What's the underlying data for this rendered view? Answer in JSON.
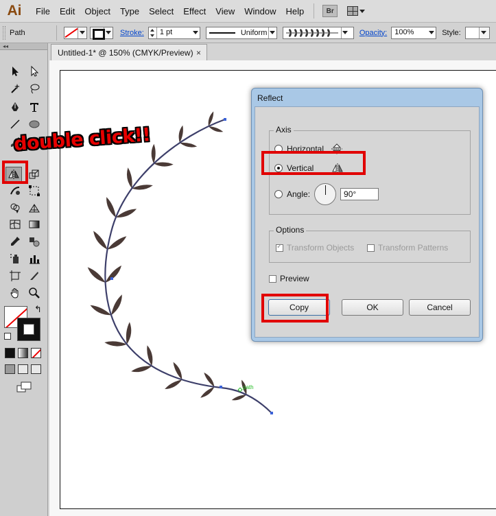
{
  "app": {
    "logo": "Ai"
  },
  "menu": [
    "File",
    "Edit",
    "Object",
    "Type",
    "Select",
    "Effect",
    "View",
    "Window",
    "Help"
  ],
  "menubar_extra": {
    "bridge": "Br"
  },
  "control_bar": {
    "selection": "Path",
    "stroke_label": "Stroke:",
    "stroke_value": "1 pt",
    "profile": "Uniform",
    "opacity_label": "Opacity:",
    "opacity_value": "100%",
    "style_label": "Style:"
  },
  "document_tab": {
    "title": "Untitled-1* @ 150% (CMYK/Preview)",
    "close": "×"
  },
  "annotation": {
    "text": "double click!!"
  },
  "artwork": {
    "smart_guide_label": "path",
    "leaf_color": "#4a3a36",
    "stem_color": "#3d3f6a"
  },
  "dialog": {
    "title": "Reflect",
    "axis": {
      "label": "Axis",
      "horizontal": "Horizontal",
      "vertical": "Vertical",
      "angle_label": "Angle:",
      "angle_value": "90°",
      "selected": "vertical"
    },
    "options": {
      "label": "Options",
      "transform_objects": "Transform Objects",
      "transform_patterns": "Transform Patterns"
    },
    "preview": "Preview",
    "buttons": {
      "copy": "Copy",
      "ok": "OK",
      "cancel": "Cancel"
    }
  },
  "colors": {
    "highlight_red": "#e10000",
    "dialog_frame": "#a9c8e6",
    "link_blue": "#0044cc"
  }
}
